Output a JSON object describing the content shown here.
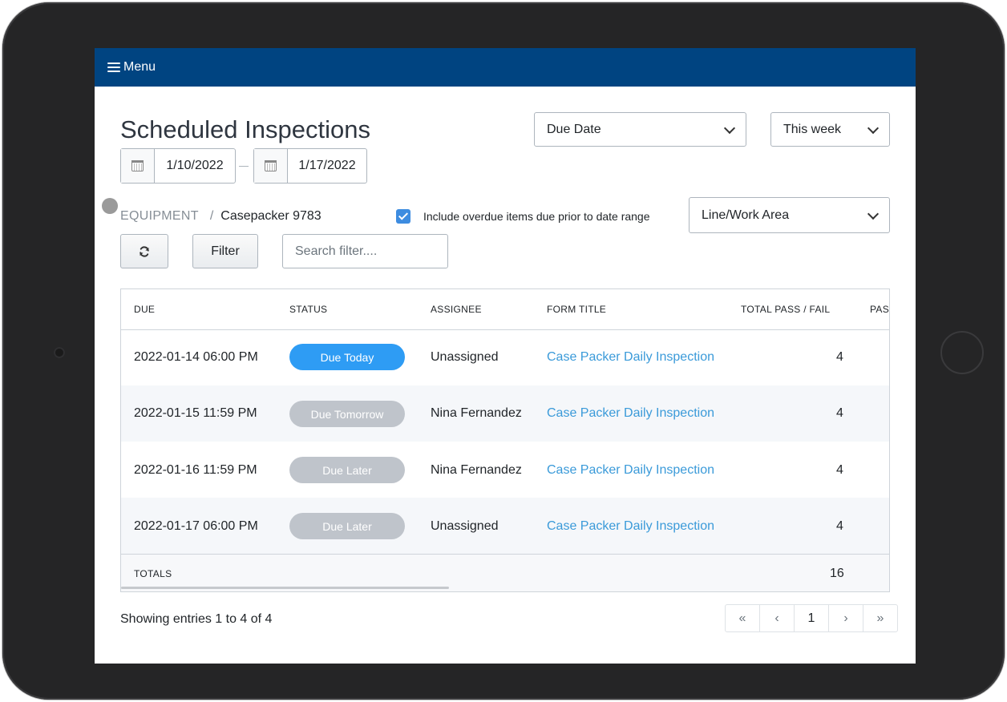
{
  "header": {
    "menu_label": "Menu"
  },
  "page": {
    "title": "Scheduled Inspections"
  },
  "filters": {
    "date_field_select": "Due Date",
    "range_select": "This week",
    "start_date": "1/10/2022",
    "end_date": "1/17/2022",
    "line_select": "Line/Work Area",
    "include_overdue_label": "Include overdue items due prior to date range",
    "include_overdue_checked": true
  },
  "breadcrumb": {
    "root": "EQUIPMENT",
    "separator": "/",
    "leaf": "Casepacker 9783"
  },
  "toolbar": {
    "filter_label": "Filter",
    "search_placeholder": "Search filter...."
  },
  "table": {
    "columns": [
      "DUE",
      "STATUS",
      "ASSIGNEE",
      "FORM TITLE",
      "TOTAL PASS / FAIL",
      "PAS"
    ],
    "rows": [
      {
        "due": "2022-01-14 06:00 PM",
        "status": "Due Today",
        "assignee": "Unassigned",
        "form": "Case Packer Daily Inspection",
        "total": "4"
      },
      {
        "due": "2022-01-15 11:59 PM",
        "status": "Due Tomorrow",
        "assignee": "Nina Fernandez",
        "form": "Case Packer Daily Inspection",
        "total": "4"
      },
      {
        "due": "2022-01-16 11:59 PM",
        "status": "Due Later",
        "assignee": "Nina Fernandez",
        "form": "Case Packer Daily Inspection",
        "total": "4"
      },
      {
        "due": "2022-01-17 06:00 PM",
        "status": "Due Later",
        "assignee": "Unassigned",
        "form": "Case Packer Daily Inspection",
        "total": "4"
      }
    ],
    "totals_label": "TOTALS",
    "totals_value": "16"
  },
  "footer": {
    "entries_text": "Showing entries 1 to 4 of 4"
  },
  "pagination": {
    "first": "«",
    "prev": "‹",
    "current": "1",
    "next": "›",
    "last": "»"
  },
  "colors": {
    "header_bg": "#004481",
    "due_today": "#2e9cf4",
    "due_later": "#bfc4cb",
    "link": "#3a9ad9",
    "checkbox": "#3d8ce0"
  }
}
